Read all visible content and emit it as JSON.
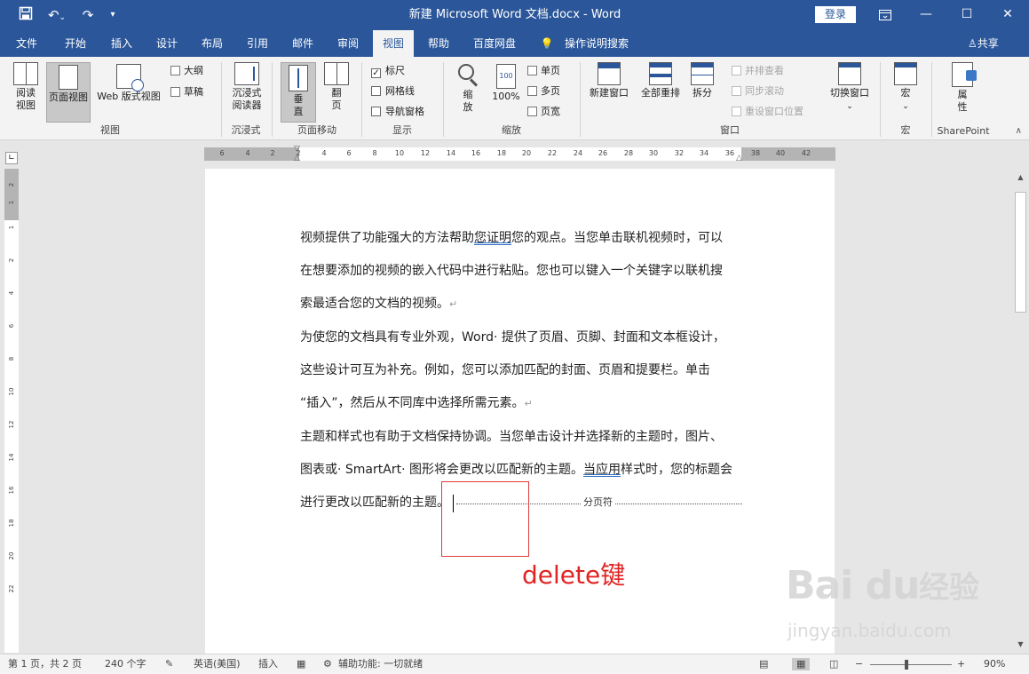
{
  "title_bar": {
    "title": "新建 Microsoft Word 文档.docx  -  Word",
    "login_label": "登录"
  },
  "menu": {
    "tabs": [
      {
        "label": "文件"
      },
      {
        "label": "开始"
      },
      {
        "label": "插入"
      },
      {
        "label": "设计"
      },
      {
        "label": "布局"
      },
      {
        "label": "引用"
      },
      {
        "label": "邮件"
      },
      {
        "label": "审阅"
      },
      {
        "label": "视图"
      },
      {
        "label": "帮助"
      },
      {
        "label": "百度网盘"
      },
      {
        "label": "操作说明搜索"
      }
    ],
    "active_tab": "视图",
    "share_label": "共享"
  },
  "ribbon": {
    "views": {
      "read_mode": "阅读视图",
      "print_layout": "页面视图",
      "web_layout": "Web 版式视图",
      "outline": "大纲",
      "draft": "草稿",
      "group_label": "视图"
    },
    "immersive": {
      "immersive_reader": "沉浸式阅读器",
      "group_label": "沉浸式"
    },
    "page_movement": {
      "vertical": "垂直",
      "side_to_side": "翻页",
      "group_label": "页面移动"
    },
    "show": {
      "ruler": "标尺",
      "ruler_checked": true,
      "gridlines": "网格线",
      "gridlines_checked": false,
      "nav_pane": "导航窗格",
      "nav_pane_checked": false,
      "group_label": "显示"
    },
    "zoom": {
      "zoom": "缩放",
      "zoom_100": "100%",
      "one_page": "单页",
      "multiple_pages": "多页",
      "page_width": "页宽",
      "group_label": "缩放"
    },
    "window": {
      "new_window": "新建窗口",
      "arrange_all": "全部重排",
      "split": "拆分",
      "side_by_side": "并排查看",
      "sync_scroll": "同步滚动",
      "reset_position": "重设窗口位置",
      "switch_windows": "切换窗口",
      "group_label": "窗口"
    },
    "macros": {
      "macros": "宏",
      "group_label": "宏"
    },
    "sharepoint": {
      "properties": "属性",
      "group_label": "SharePoint"
    }
  },
  "ruler": {
    "h_ticks": [
      "6",
      "4",
      "2",
      "2",
      "4",
      "6",
      "8",
      "10",
      "12",
      "14",
      "16",
      "18",
      "20",
      "22",
      "24",
      "26",
      "28",
      "30",
      "32",
      "34",
      "36",
      "38",
      "40",
      "42"
    ],
    "v_ticks": [
      "2",
      "1",
      "1",
      "2",
      "4",
      "6",
      "8",
      "10",
      "12",
      "14",
      "16",
      "18",
      "20",
      "22"
    ]
  },
  "document": {
    "lines": [
      {
        "parts": [
          {
            "t": "视频提供了功能强大的方法帮助"
          },
          {
            "t": "您证明",
            "u": true
          },
          {
            "t": "您的观点。当您单击联机视频时，可以"
          }
        ]
      },
      {
        "parts": [
          {
            "t": "在想要添加的视频的嵌入代码中进行粘贴。您也可以键入一个关键字以联机搜"
          }
        ]
      },
      {
        "parts": [
          {
            "t": "索最适合您的文档的视频。"
          },
          {
            "t": "↵",
            "pm": true
          }
        ]
      },
      {
        "parts": [
          {
            "t": "为使您的文档具有专业外观，Word· 提供了页眉、页脚、封面和文本框设计，"
          }
        ]
      },
      {
        "parts": [
          {
            "t": "这些设计可互为补充。例如，您可以添加匹配的封面、页眉和提要栏。单击"
          }
        ]
      },
      {
        "parts": [
          {
            "t": "“插入”，然后从不同库中选择所需元素。"
          },
          {
            "t": "↵",
            "pm": true
          }
        ]
      },
      {
        "parts": [
          {
            "t": "主题和样式也有助于文档保持协调。当您单击设计并选择新的主题时，图片、"
          }
        ]
      },
      {
        "parts": [
          {
            "t": "图表或· SmartArt· 图形将会更改以匹配新的主题。"
          },
          {
            "t": "当应用",
            "u": true
          },
          {
            "t": "样式时，您的标题会"
          }
        ]
      },
      {
        "parts": [
          {
            "t": "进行更改以匹配新的主题。"
          }
        ]
      }
    ],
    "page_break_label": "分页符"
  },
  "annotation": {
    "text": "delete键",
    "color": "#e02424"
  },
  "watermark": {
    "brand": "Bai du",
    "brand_cn": "经验",
    "url": "jingyan.baidu.com"
  },
  "status_bar": {
    "page": "第 1 页，共 2 页",
    "word_count": "240 个字",
    "language": "英语(美国)",
    "insert_mode": "插入",
    "accessibility": "辅助功能: 一切就绪",
    "zoom": "90%",
    "zoom_level": 0.9
  },
  "colors": {
    "brand": "#2b579a",
    "ribbon_bg": "#f3f3f3",
    "annotation": "#e02424"
  }
}
